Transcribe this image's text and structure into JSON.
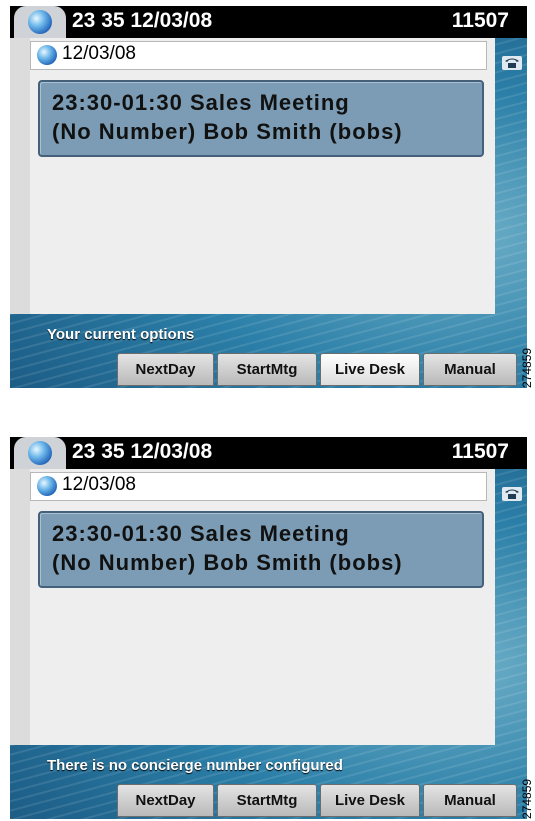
{
  "screens": [
    {
      "title_time": "23 35 12/03/08",
      "title_ext": "11507",
      "date_header": "12/03/08",
      "meeting_line1": "23:30-01:30 Sales Meeting",
      "meeting_line2": "(No Number) Bob Smith (bobs)",
      "status_text": "Your current options",
      "softkeys": [
        "NextDay",
        "StartMtg",
        "Live Desk",
        "Manual"
      ],
      "ref_number": "274859"
    },
    {
      "title_time": "23 35 12/03/08",
      "title_ext": "11507",
      "date_header": "12/03/08",
      "meeting_line1": "23:30-01:30 Sales Meeting",
      "meeting_line2": "(No Number) Bob Smith (bobs)",
      "status_text": "There is no concierge number configured",
      "softkeys": [
        "NextDay",
        "StartMtg",
        "Live Desk",
        "Manual"
      ],
      "ref_number": "274859"
    }
  ],
  "colors": {
    "titlebar": "#000000",
    "item_bg": "#7b9cb4",
    "wallpaper": "#1f6690"
  },
  "icons": [
    "globe-icon",
    "phone-icon"
  ]
}
